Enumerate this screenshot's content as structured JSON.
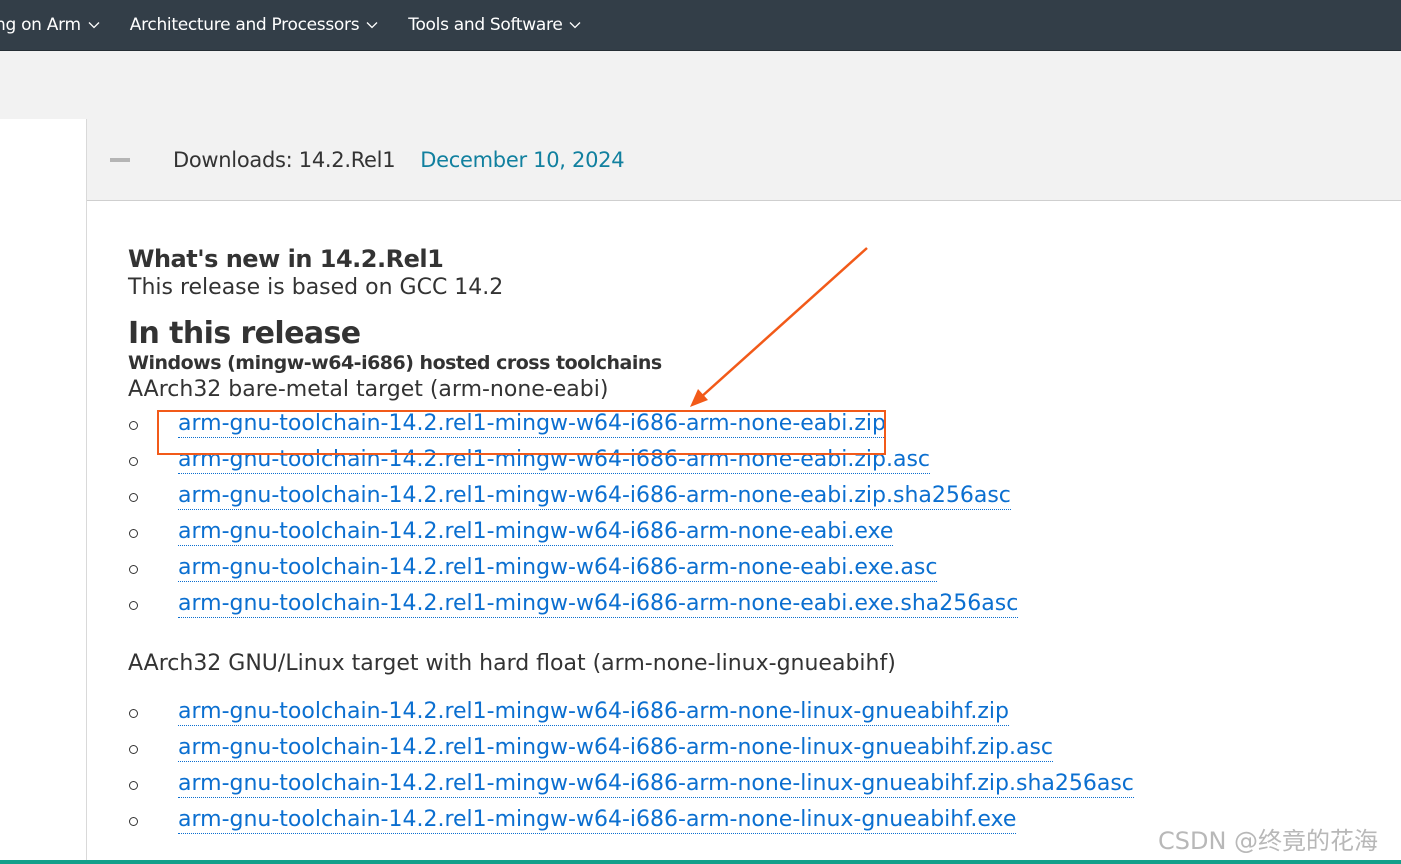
{
  "nav": {
    "items": [
      {
        "label": "oping on Arm"
      },
      {
        "label": "Architecture and Processors"
      },
      {
        "label": "Tools and Software"
      }
    ]
  },
  "accordion": {
    "title": "Downloads: 14.2.Rel1",
    "date": "December 10, 2024"
  },
  "content": {
    "whats_new_heading": "What's new in 14.2.Rel1",
    "based_on": "This release is based on GCC 14.2",
    "in_release_heading": "In this release",
    "host_heading": "Windows (mingw-w64-i686) hosted cross toolchains",
    "sections": [
      {
        "target": "AArch32 bare-metal target (arm-none-eabi)",
        "files": [
          "arm-gnu-toolchain-14.2.rel1-mingw-w64-i686-arm-none-eabi.zip",
          "arm-gnu-toolchain-14.2.rel1-mingw-w64-i686-arm-none-eabi.zip.asc",
          "arm-gnu-toolchain-14.2.rel1-mingw-w64-i686-arm-none-eabi.zip.sha256asc",
          "arm-gnu-toolchain-14.2.rel1-mingw-w64-i686-arm-none-eabi.exe",
          "arm-gnu-toolchain-14.2.rel1-mingw-w64-i686-arm-none-eabi.exe.asc",
          "arm-gnu-toolchain-14.2.rel1-mingw-w64-i686-arm-none-eabi.exe.sha256asc"
        ]
      },
      {
        "target": "AArch32 GNU/Linux target with hard float (arm-none-linux-gnueabihf)",
        "files": [
          "arm-gnu-toolchain-14.2.rel1-mingw-w64-i686-arm-none-linux-gnueabihf.zip",
          "arm-gnu-toolchain-14.2.rel1-mingw-w64-i686-arm-none-linux-gnueabihf.zip.asc",
          "arm-gnu-toolchain-14.2.rel1-mingw-w64-i686-arm-none-linux-gnueabihf.zip.sha256asc",
          "arm-gnu-toolchain-14.2.rel1-mingw-w64-i686-arm-none-linux-gnueabihf.exe"
        ]
      }
    ]
  },
  "watermark": "CSDN @终竟的花海",
  "colors": {
    "nav_bg": "#333e48",
    "link": "#0b6fd0",
    "date": "#11809f",
    "annotation": "#f25a19"
  },
  "icons": {
    "nav_dropdown": "chevron-down-icon",
    "accordion_toggle": "minus-icon",
    "list_bullet": "circle-bullet-icon",
    "annotation": "arrow-icon"
  }
}
